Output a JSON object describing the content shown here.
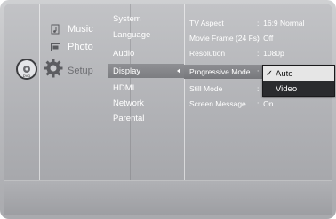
{
  "main_menu": {
    "items": [
      {
        "label": "Music",
        "icon": "music-icon"
      },
      {
        "label": "Photo",
        "icon": "photo-icon"
      },
      {
        "label": "Setup",
        "icon": "gear-icon"
      }
    ]
  },
  "sub_menu": {
    "items": [
      "System",
      "Language",
      "Audio",
      "Display",
      "HDMI",
      "Network",
      "Parental"
    ],
    "selected": "Display"
  },
  "settings": [
    {
      "name": "TV Aspect",
      "value": "16:9 Normal"
    },
    {
      "name": "Movie Frame (24 Fs)",
      "value": "Off"
    },
    {
      "name": "Resolution",
      "value": "1080p"
    },
    {
      "name": "Progressive Mode",
      "value": ""
    },
    {
      "name": "Still Mode",
      "value": ""
    },
    {
      "name": "Screen Message",
      "value": "On"
    }
  ],
  "separator": ":",
  "popup": {
    "options": [
      {
        "label": "Auto",
        "checked": true
      },
      {
        "label": "Video",
        "checked": false
      }
    ]
  },
  "colors": {
    "menu_text": "#ffffff",
    "setup_text": "#6c6d71",
    "popup_bg": "#2a2b2e",
    "popup_selected_bg": "#e6e6e6"
  },
  "disc_icon": "disc-icon"
}
